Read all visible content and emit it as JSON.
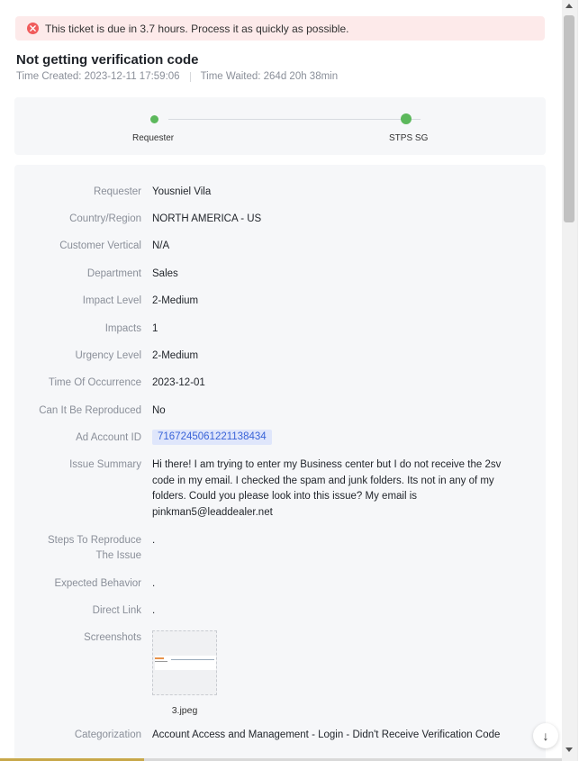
{
  "alert": {
    "text": "This ticket is due in 3.7 hours. Process it as quickly as possible."
  },
  "ticket": {
    "title": "Not getting verification code",
    "time_created": "Time Created: 2023-12-11 17:59:06",
    "time_waited": "Time Waited: 264d 20h 38min"
  },
  "flow": {
    "steps": [
      "Requester",
      "STPS SG"
    ],
    "status_color": "#5cb85c"
  },
  "details": {
    "requester_label": "Requester",
    "requester": "Yousniel Vila",
    "country_label": "Country/Region",
    "country": "NORTH AMERICA - US",
    "vertical_label": "Customer Vertical",
    "vertical": "N/A",
    "department_label": "Department",
    "department": "Sales",
    "impact_level_label": "Impact Level",
    "impact_level": "2-Medium",
    "impacts_label": "Impacts",
    "impacts": "1",
    "urgency_label": "Urgency Level",
    "urgency": "2-Medium",
    "occurrence_label": "Time Of Occurrence",
    "occurrence": "2023-12-01",
    "reproduced_label": "Can It Be Reproduced",
    "reproduced": "No",
    "ad_account_label": "Ad Account ID",
    "ad_account": "7167245061221138434",
    "summary_label": "Issue Summary",
    "summary": "Hi there! I am trying to enter my Business center but I do not receive the 2sv code in my email. I checked the spam and junk folders. Its not in any of my folders. Could you please look into this issue? My email is pinkman5@leaddealer.net",
    "steps_label_1": "Steps To Reproduce",
    "steps_label_2": "The Issue",
    "steps": ".",
    "expected_label": "Expected Behavior",
    "expected": ".",
    "link_label": "Direct Link",
    "link": ".",
    "screenshots_label": "Screenshots",
    "screenshot_file": "3.jpeg",
    "categorization_label": "Categorization",
    "categorization": "Account Access and Management - Login - Didn't Receive Verification Code"
  },
  "colors": {
    "alert_bg": "#fdeaea",
    "alert_icon": "#f05b5b",
    "badge_bg": "#dfe6fb",
    "badge_text": "#3a64d8"
  },
  "icons": {
    "alert": "error-x-icon",
    "scroll_down": "arrow-down-icon"
  }
}
